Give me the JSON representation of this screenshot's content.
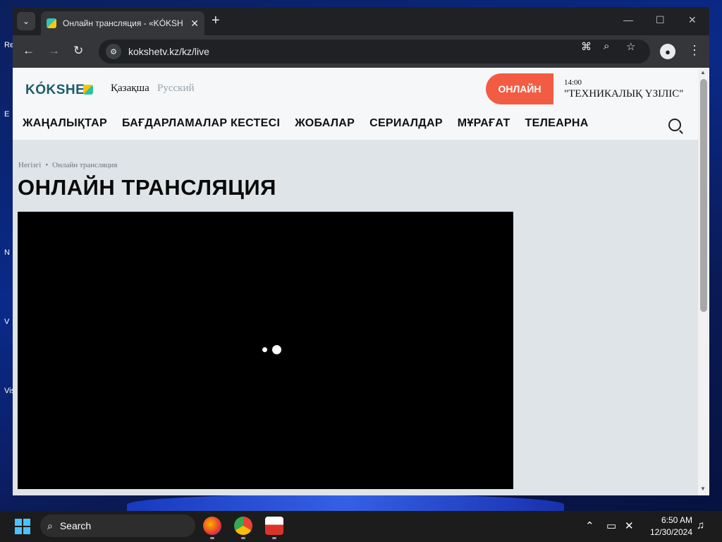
{
  "desktop": {
    "icons": [
      "Re",
      "E",
      "N",
      "V",
      "Vis"
    ]
  },
  "browser": {
    "tab": {
      "title": "Онлайн трансляция - «KÓKSHE",
      "close_glyph": "✕"
    },
    "new_tab_glyph": "+",
    "url": "kokshetv.kz/kz/live"
  },
  "site": {
    "logo": "KÓKSHE",
    "lang_kz": "Қазақша",
    "lang_ru": "Русский",
    "live_button": "ОНЛАЙН",
    "schedule": {
      "time": "14:00",
      "title": "\"ТЕХНИКАЛЫҚ ҮЗІЛІС\""
    },
    "menu": [
      "ЖАҢАЛЫҚТАР",
      "БАҒДАРЛАМАЛАР КЕСТЕСІ",
      "ЖОБАЛАР",
      "СЕРИАЛДАР",
      "МҰРАҒАТ",
      "ТЕЛЕАРНА"
    ],
    "breadcrumb": {
      "home": "Негізгі",
      "sep": "•",
      "current": "Онлайн трансляция"
    },
    "page_title": "ОНЛАЙН ТРАНСЛЯЦИЯ"
  },
  "taskbar": {
    "search_placeholder": "Search",
    "time": "6:50 AM",
    "date": "12/30/2024"
  },
  "colors": {
    "live_accent": "#f25c43",
    "logo_text": "#1c5b6b",
    "page_bg": "#dfe4e8",
    "player_bg": "#000000"
  }
}
